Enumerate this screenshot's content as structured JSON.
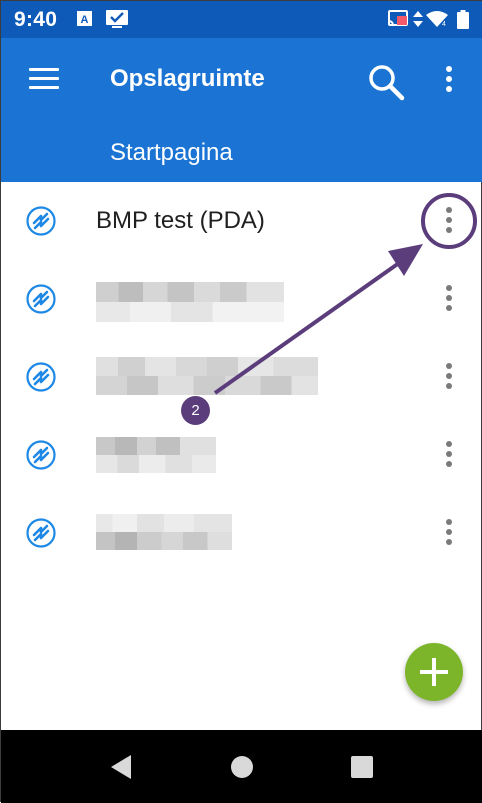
{
  "status_bar": {
    "time": "9:40",
    "icons": [
      "text-notification-icon",
      "checkmark-notification-icon",
      "cast-icon",
      "data-transfer-icon",
      "wifi-icon",
      "battery-icon"
    ]
  },
  "app_bar": {
    "title": "Opslagruimte",
    "tab": "Startpagina",
    "icons": [
      "menu-icon",
      "search-icon",
      "more-vert-icon"
    ]
  },
  "list": {
    "items": [
      {
        "label": "BMP test (PDA)",
        "blurred": false
      },
      {
        "label": "",
        "blurred": true
      },
      {
        "label": "",
        "blurred": true
      },
      {
        "label": "",
        "blurred": true
      },
      {
        "label": "",
        "blurred": true
      }
    ]
  },
  "annotation": {
    "step_number": "2",
    "color": "#5b3d7c"
  },
  "colors": {
    "status_bar": "#0e5ab8",
    "app_bar": "#1b74d4",
    "fab": "#7cb52a",
    "row_icon": "#1e88e5"
  },
  "fab": {
    "icon": "plus-icon"
  },
  "nav_bar": {
    "icons": [
      "back-icon",
      "home-icon",
      "recents-icon"
    ]
  }
}
